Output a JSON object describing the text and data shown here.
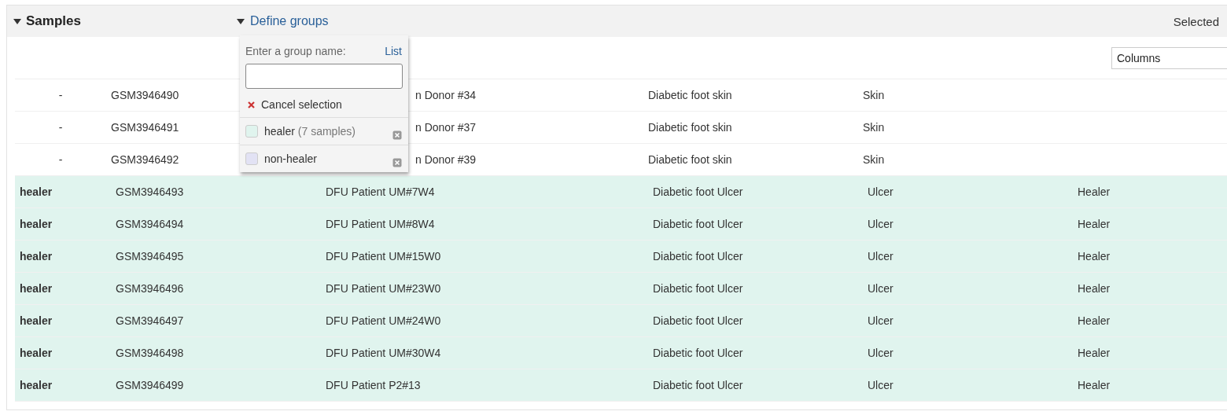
{
  "panel": {
    "title": "Samples",
    "expanded": true,
    "define_groups": {
      "label": "Define groups",
      "expanded": true
    },
    "selected_label": "Selected"
  },
  "columns_select": {
    "value": "Columns"
  },
  "group_popup": {
    "prompt": "Enter a group name:",
    "list_link": "List",
    "cancel": "Cancel selection",
    "groups": [
      {
        "name": "healer",
        "count": "(7 samples)",
        "color": "#e0f4ee"
      },
      {
        "name": "non-healer",
        "color": "#e2e2f4"
      }
    ]
  },
  "rows": [
    {
      "group": "-",
      "accession": "GSM3946490",
      "title": "n Donor #34",
      "covered": true,
      "source": "Diabetic foot skin",
      "tissue": "Skin",
      "color": "#ffffff"
    },
    {
      "group": "-",
      "accession": "GSM3946491",
      "title": "n Donor #37",
      "covered": true,
      "source": "Diabetic foot skin",
      "tissue": "Skin",
      "color": "#ffffff"
    },
    {
      "group": "-",
      "accession": "GSM3946492",
      "title": "n Donor #39",
      "covered": true,
      "source": "Diabetic foot skin",
      "tissue": "Skin",
      "color": "#ffffff"
    },
    {
      "group": "healer",
      "accession": "GSM3946493",
      "title": "DFU Patient UM#7W4",
      "covered": false,
      "source": "Diabetic foot Ulcer",
      "tissue": "Ulcer",
      "outcome": "Healer",
      "color": "#e0f4ee"
    },
    {
      "group": "healer",
      "accession": "GSM3946494",
      "title": "DFU Patient UM#8W4",
      "covered": false,
      "source": "Diabetic foot Ulcer",
      "tissue": "Ulcer",
      "outcome": "Healer",
      "color": "#e0f4ee"
    },
    {
      "group": "healer",
      "accession": "GSM3946495",
      "title": "DFU Patient UM#15W0",
      "covered": false,
      "source": "Diabetic foot Ulcer",
      "tissue": "Ulcer",
      "outcome": "Healer",
      "color": "#e0f4ee"
    },
    {
      "group": "healer",
      "accession": "GSM3946496",
      "title": "DFU Patient UM#23W0",
      "covered": false,
      "source": "Diabetic foot Ulcer",
      "tissue": "Ulcer",
      "outcome": "Healer",
      "color": "#e0f4ee"
    },
    {
      "group": "healer",
      "accession": "GSM3946497",
      "title": "DFU Patient UM#24W0",
      "covered": false,
      "source": "Diabetic foot Ulcer",
      "tissue": "Ulcer",
      "outcome": "Healer",
      "color": "#e0f4ee"
    },
    {
      "group": "healer",
      "accession": "GSM3946498",
      "title": "DFU Patient UM#30W4",
      "covered": false,
      "source": "Diabetic foot Ulcer",
      "tissue": "Ulcer",
      "outcome": "Healer",
      "color": "#e0f4ee"
    },
    {
      "group": "healer",
      "accession": "GSM3946499",
      "title": "DFU Patient P2#13",
      "covered": false,
      "source": "Diabetic foot Ulcer",
      "tissue": "Ulcer",
      "outcome": "Healer",
      "color": "#e0f4ee"
    }
  ]
}
